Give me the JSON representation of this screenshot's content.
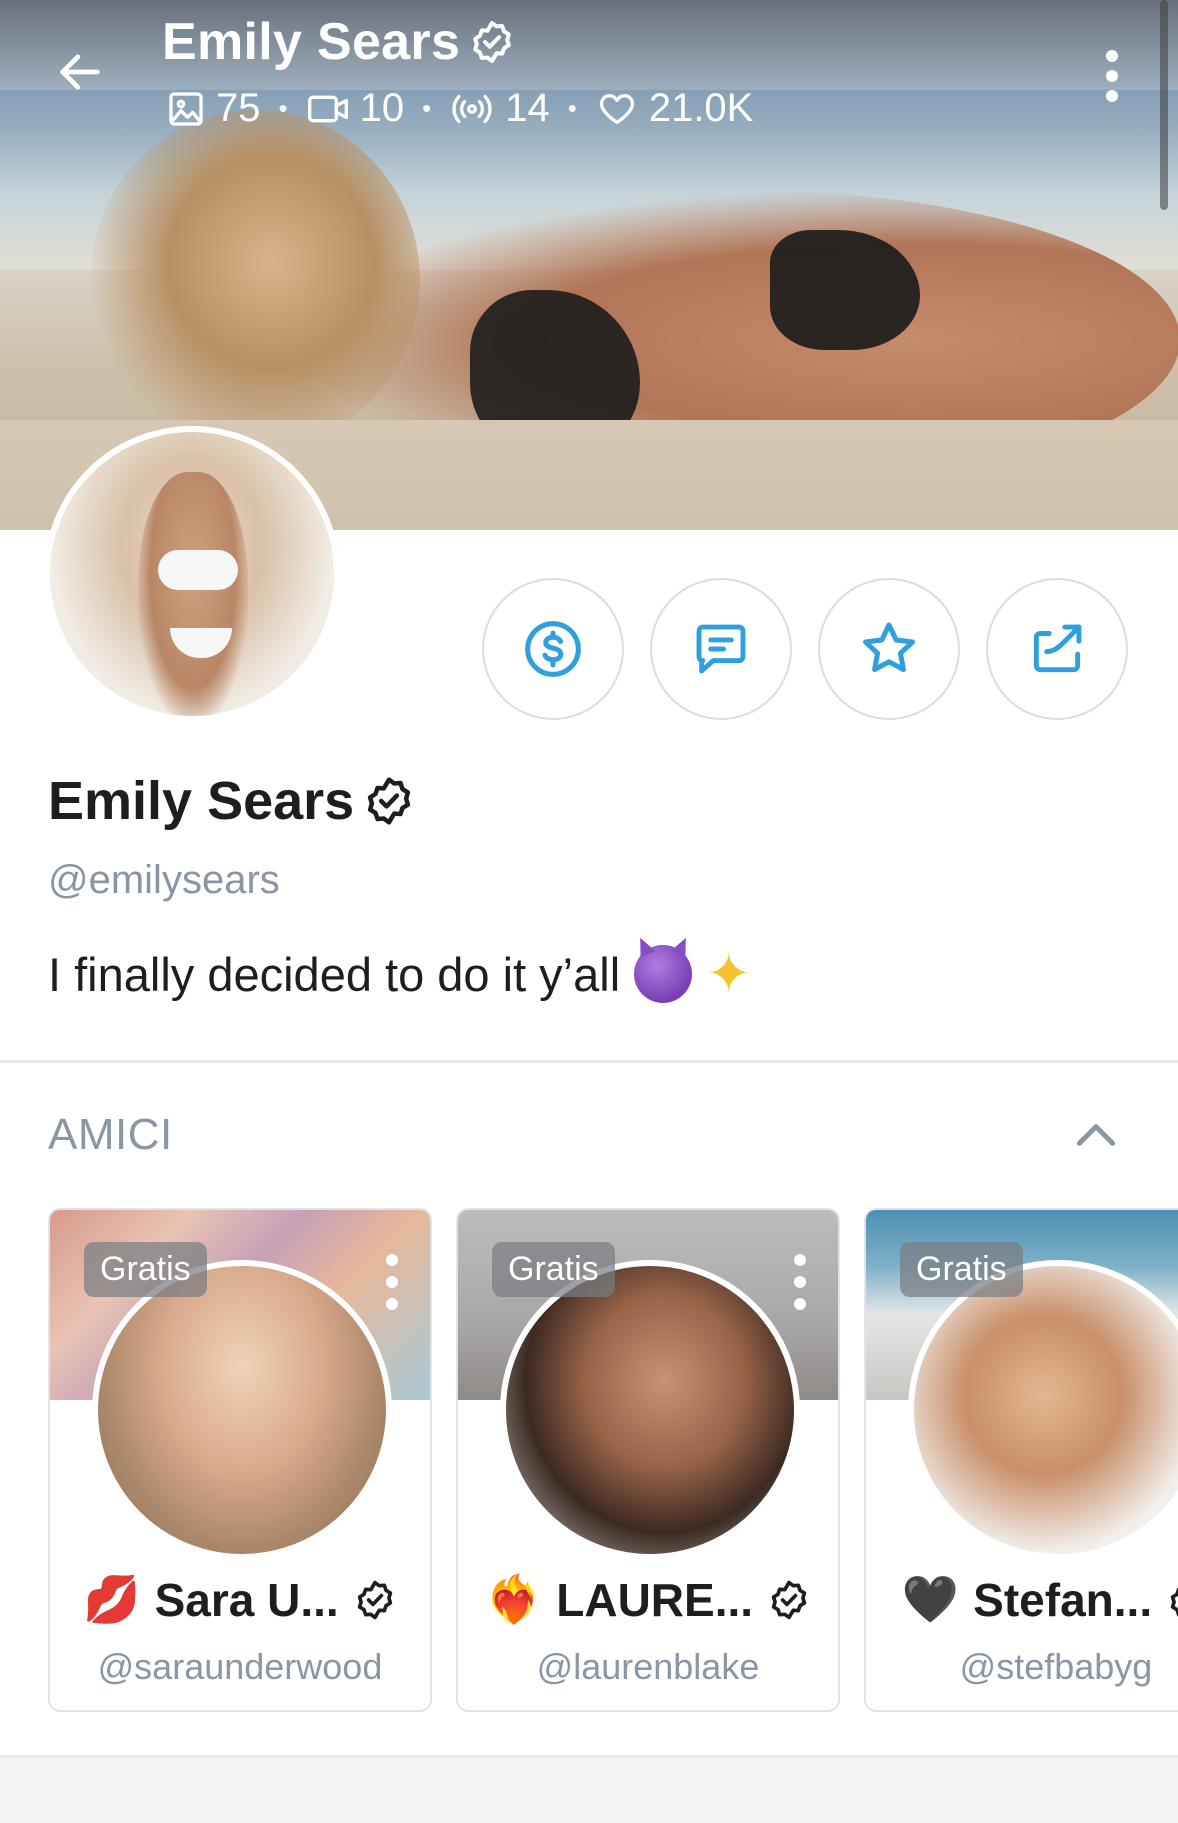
{
  "header": {
    "title": "Emily Sears",
    "stats": {
      "photos": "75",
      "videos": "10",
      "streams": "14",
      "likes": "21.0K"
    }
  },
  "profile": {
    "name": "Emily Sears",
    "handle": "@emilysears",
    "bio": "I finally decided to do it y’all"
  },
  "friends": {
    "section_title": "AMICI",
    "cards": [
      {
        "badge": "Gratis",
        "name": "Sara U...",
        "handle": "@saraunderwood",
        "emoji": "💋"
      },
      {
        "badge": "Gratis",
        "name": "LAURE...",
        "handle": "@laurenblake",
        "emoji": "❤️‍🔥"
      },
      {
        "badge": "Gratis",
        "name": "Stefan...",
        "handle": "@stefbabyg",
        "emoji": "🖤"
      }
    ]
  },
  "colors": {
    "accent": "#2f9fe0",
    "muted": "#8a96a3",
    "text": "#1c1e21",
    "border": "#d8dde3"
  },
  "icons": {
    "back": "arrow-left-icon",
    "photos": "image-icon",
    "videos": "video-icon",
    "streams": "broadcast-icon",
    "likes": "heart-icon",
    "verified": "verified-badge-icon",
    "tip": "dollar-circle-icon",
    "message": "message-icon",
    "favorite": "star-icon",
    "share": "share-icon",
    "collapse": "chevron-up-icon"
  }
}
